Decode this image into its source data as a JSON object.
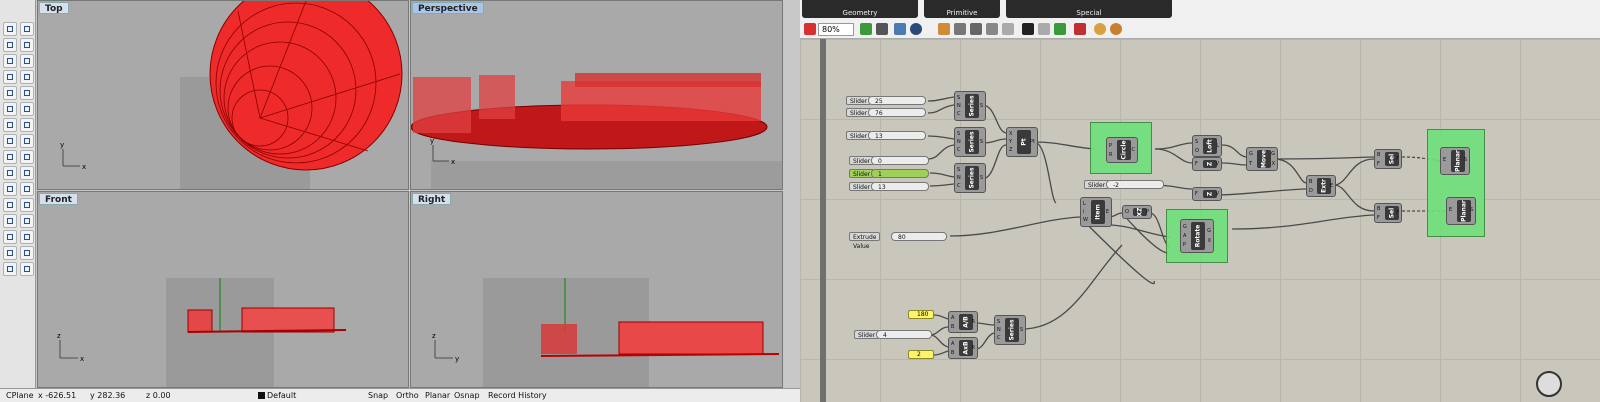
{
  "viewports": {
    "top": {
      "title": "Top"
    },
    "perspective": {
      "title": "Perspective"
    },
    "front": {
      "title": "Front"
    },
    "right": {
      "title": "Right"
    },
    "axis": {
      "x": "x",
      "y": "y",
      "z": "z"
    }
  },
  "status": {
    "cplane": "CPlane",
    "x": "x -626.51",
    "y": "y 282.36",
    "z": "z 0.00",
    "layer": "Default",
    "snap": "Snap",
    "ortho": "Ortho",
    "planar": "Planar",
    "osnap": "Osnap",
    "history": "Record History"
  },
  "grasshopper": {
    "tabs": [
      "Geometry",
      "Primitive",
      "Special"
    ],
    "zoom": "80%",
    "sliders": [
      {
        "label": "Slider",
        "value": "25"
      },
      {
        "label": "Slider",
        "value": "76"
      },
      {
        "label": "Slider",
        "value": "13"
      },
      {
        "label": "Slider",
        "value": "0"
      },
      {
        "label": "Slider",
        "value": "1"
      },
      {
        "label": "Slider",
        "value": "13"
      },
      {
        "label": "Slider",
        "value": "-2"
      },
      {
        "label": "Extrude Value",
        "value": "80"
      },
      {
        "label": "Slider",
        "value": "4"
      }
    ],
    "panels": [
      "180",
      "2"
    ],
    "components": {
      "series1": {
        "name": "Series",
        "in": [
          "S",
          "N",
          "C"
        ],
        "out": [
          "S"
        ]
      },
      "series2": {
        "name": "Series",
        "in": [
          "S",
          "N",
          "C"
        ],
        "out": [
          "S"
        ]
      },
      "series3": {
        "name": "Series",
        "in": [
          "S",
          "N",
          "C"
        ],
        "out": [
          "S"
        ]
      },
      "pt": {
        "name": "Pt",
        "in": [
          "X",
          "Y",
          "Z"
        ],
        "out": [
          "Pt"
        ]
      },
      "circle": {
        "name": "Circle",
        "in": [
          "P",
          "R"
        ],
        "out": [
          "C"
        ]
      },
      "loft": {
        "name": "Loft",
        "in": [
          "S",
          "O"
        ],
        "out": [
          "L"
        ]
      },
      "z1": {
        "name": "Z",
        "in": [
          "F"
        ],
        "out": [
          "V"
        ]
      },
      "move": {
        "name": "Move",
        "in": [
          "G",
          "T"
        ],
        "out": [
          "G",
          "X"
        ]
      },
      "extr": {
        "name": "Extr",
        "in": [
          "B",
          "D"
        ],
        "out": [
          "E"
        ]
      },
      "z2": {
        "name": "Z",
        "in": [
          "F"
        ],
        "out": [
          "V"
        ]
      },
      "item": {
        "name": "Item",
        "in": [
          "L",
          "i",
          "W"
        ],
        "out": [
          "E"
        ]
      },
      "xz": {
        "name": "XZ",
        "in": [
          "O"
        ],
        "out": [
          "P"
        ]
      },
      "rotate": {
        "name": "Rotate",
        "in": [
          "G",
          "A",
          "P"
        ],
        "out": [
          "G",
          "X"
        ]
      },
      "sel1": {
        "name": "Sel",
        "in": [
          "B",
          "F"
        ],
        "out": [
          "F"
        ]
      },
      "sel2": {
        "name": "Sel",
        "in": [
          "B",
          "F"
        ],
        "out": [
          "F"
        ]
      },
      "planar1": {
        "name": "Planar",
        "in": [
          "E"
        ],
        "out": [
          "S"
        ]
      },
      "planar2": {
        "name": "Planar",
        "in": [
          "E"
        ],
        "out": [
          "S"
        ]
      },
      "ab1": {
        "name": "A/B",
        "in": [
          "A",
          "B"
        ],
        "out": [
          "R"
        ]
      },
      "axb": {
        "name": "AxB",
        "in": [
          "A",
          "B"
        ],
        "out": [
          "R"
        ]
      },
      "series4": {
        "name": "Series",
        "in": [
          "S",
          "N",
          "C"
        ],
        "out": [
          "S"
        ]
      }
    }
  },
  "colors": {
    "geometry": "#e8121a",
    "group": "#6ee07a",
    "panel": "#fff36a"
  }
}
